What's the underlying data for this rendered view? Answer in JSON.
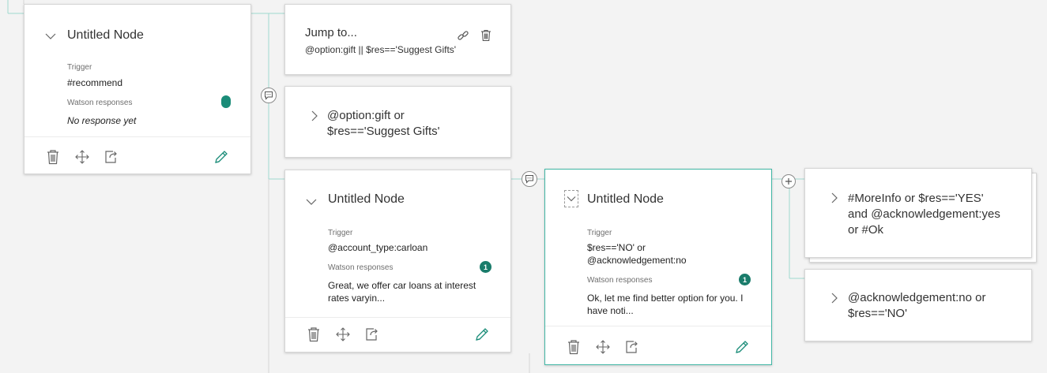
{
  "nodes": {
    "recommend": {
      "title": "Untitled Node",
      "trigger_label": "Trigger",
      "trigger_value": "#recommend",
      "responses_label": "Watson responses",
      "responses_value": "No response yet"
    },
    "jump": {
      "title": "Jump to...",
      "condition": "@option:gift || $res=='Suggest Gifts'"
    },
    "gift": {
      "line1": "@option:gift or",
      "line2": "$res=='Suggest Gifts'"
    },
    "carloan": {
      "title": "Untitled Node",
      "trigger_label": "Trigger",
      "trigger_value": "@account_type:carloan",
      "responses_label": "Watson responses",
      "responses_count": "1",
      "response_line1": "Great, we offer car loans at interest",
      "response_line2": "rates varyin..."
    },
    "res_no": {
      "title": "Untitled Node",
      "trigger_label": "Trigger",
      "trigger_line1": "$res=='NO' or",
      "trigger_line2": "@acknowledgement:no",
      "responses_label": "Watson responses",
      "responses_count": "1",
      "response_line1": "Ok, let me find better option for you. I",
      "response_line2": "have noti..."
    },
    "moreinfo": {
      "line1": "#MoreInfo or $res=='YES'",
      "line2": "and @acknowledgement:yes",
      "line3": "or #Ok"
    },
    "ack_no": {
      "line1": "@acknowledgement:no or",
      "line2": "$res=='NO'"
    }
  },
  "icons": {
    "delete": "trash-icon",
    "move": "move-icon",
    "jump": "jump-to-icon",
    "edit": "pencil-icon",
    "link": "link-icon",
    "expand": "chevron-right-icon",
    "collapse": "chevron-down-icon",
    "response": "speech-bubble-icon",
    "add": "plus-icon"
  },
  "colors": {
    "accent": "#41b6a5",
    "badge": "#1a7c6b",
    "edit": "#1a8c78",
    "connector": "#7ccfc2"
  }
}
